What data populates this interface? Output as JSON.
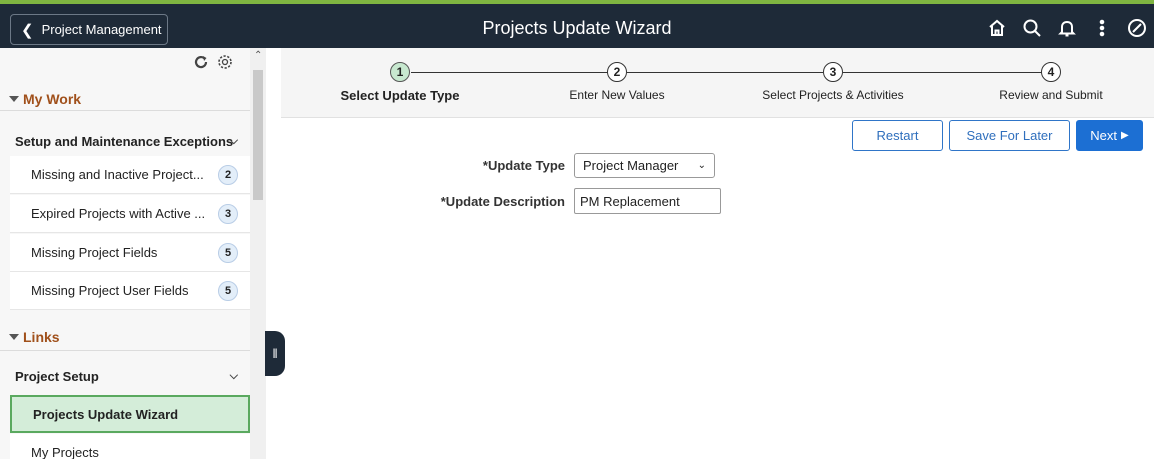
{
  "header": {
    "back_label": "Project Management",
    "title": "Projects Update Wizard",
    "icons": [
      "home-icon",
      "search-icon",
      "bell-icon",
      "more-icon",
      "compass-icon"
    ],
    "accent_color": "#7fb541"
  },
  "nav": {
    "my_work": {
      "title": "My Work",
      "group": "Setup and Maintenance Exceptions",
      "items": [
        {
          "label": "Missing and Inactive Project...",
          "count": "2"
        },
        {
          "label": "Expired Projects with Active ...",
          "count": "3"
        },
        {
          "label": "Missing Project Fields",
          "count": "5"
        },
        {
          "label": "Missing Project User Fields",
          "count": "5"
        }
      ]
    },
    "links": {
      "title": "Links",
      "group": "Project Setup",
      "items": [
        {
          "label": "Projects Update Wizard",
          "active": true
        },
        {
          "label": "My Projects"
        }
      ]
    }
  },
  "train": {
    "steps": [
      {
        "num": "1",
        "label": "Select Update Type",
        "current": true
      },
      {
        "num": "2",
        "label": "Enter New Values"
      },
      {
        "num": "3",
        "label": "Select Projects & Activities"
      },
      {
        "num": "4",
        "label": "Review and Submit"
      }
    ]
  },
  "actions": {
    "restart": "Restart",
    "save_later": "Save For Later",
    "next": "Next"
  },
  "form": {
    "update_type_label": "*Update Type",
    "update_type_value": "Project Manager",
    "update_desc_label": "*Update Description",
    "update_desc_value": "PM Replacement"
  }
}
